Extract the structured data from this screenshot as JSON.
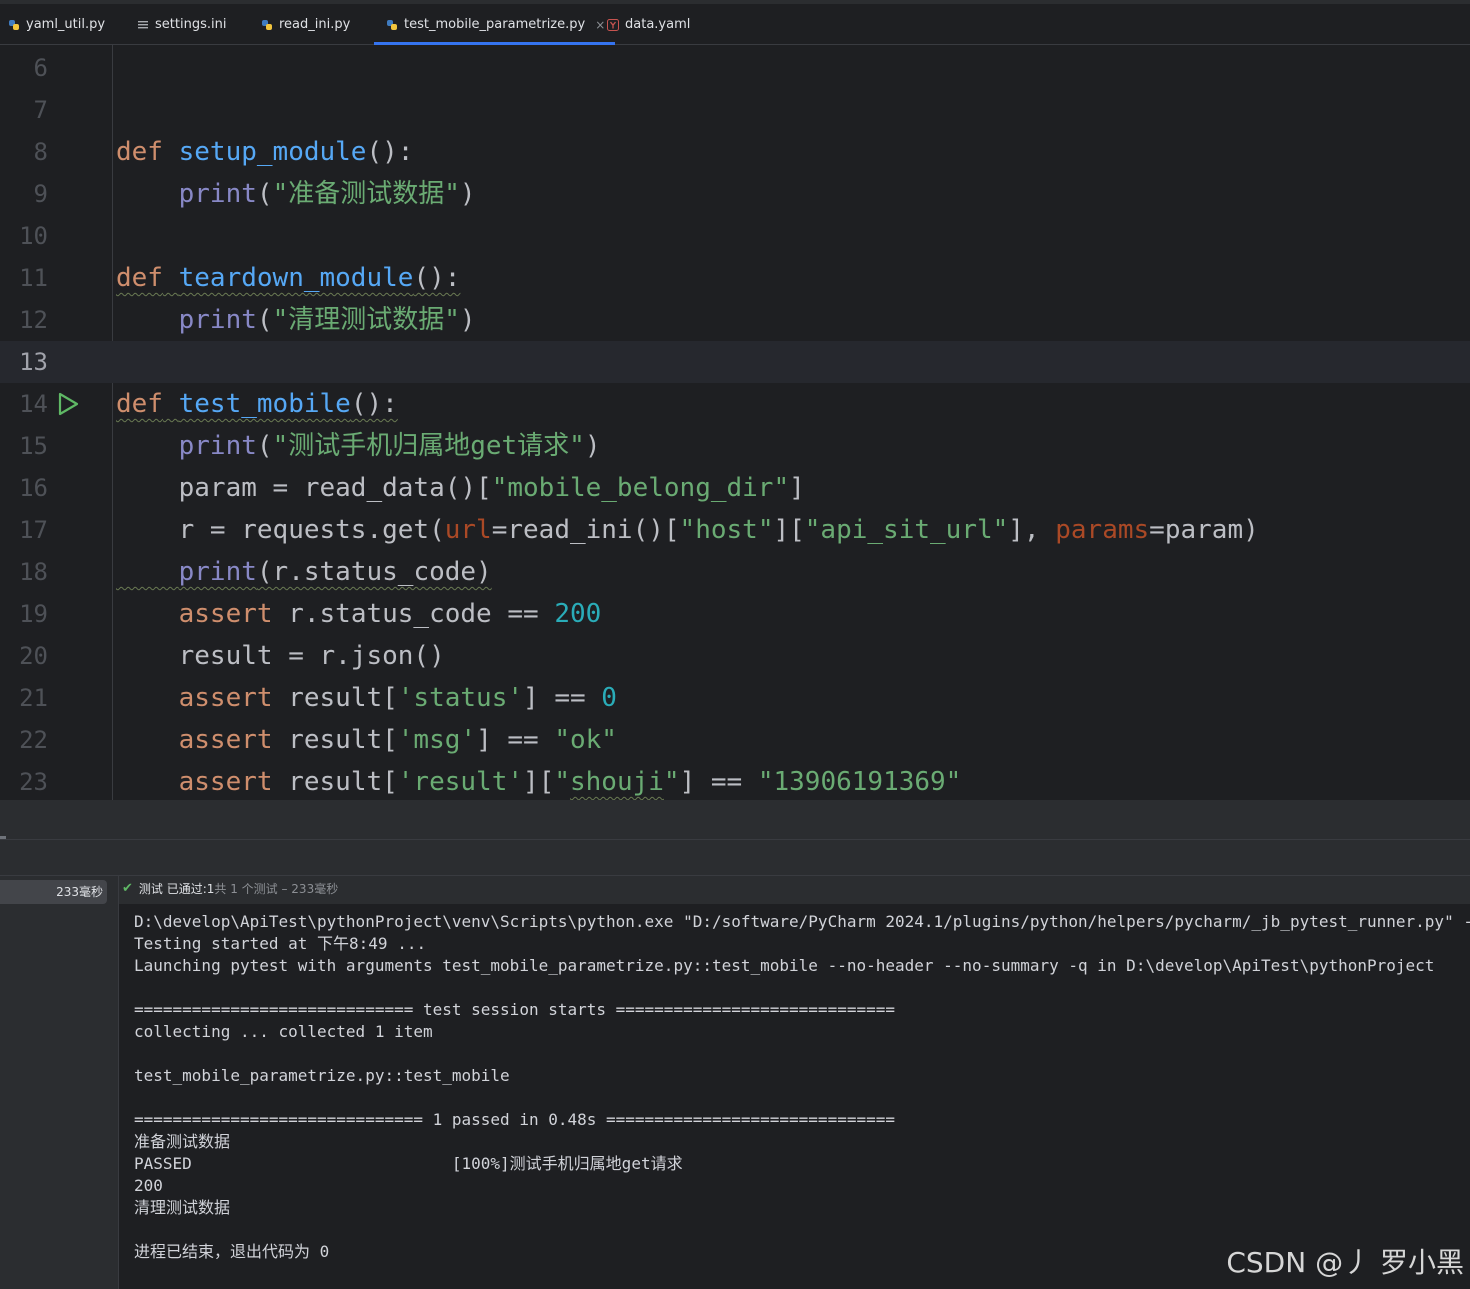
{
  "tabs": [
    {
      "label": "yaml_util.py",
      "icon": "python-icon"
    },
    {
      "label": "settings.ini",
      "icon": "ini-file-icon"
    },
    {
      "label": "read_ini.py",
      "icon": "python-icon"
    },
    {
      "label": "test_mobile_parametrize.py",
      "icon": "python-icon",
      "active": true,
      "close": "×"
    },
    {
      "label": "data.yaml",
      "icon": "yaml-icon"
    }
  ],
  "editor": {
    "line_numbers": [
      "6",
      "7",
      "8",
      "9",
      "10",
      "11",
      "12",
      "13",
      "14",
      "15",
      "16",
      "17",
      "18",
      "19",
      "20",
      "21",
      "22",
      "23"
    ],
    "current_line": "13",
    "code": {
      "l8": {
        "kw": "def",
        "fn": "setup_module",
        "tail": "():"
      },
      "l9": {
        "fn": "print",
        "a": "(",
        "str": "\"准备测试数据\"",
        "b": ")"
      },
      "l11": {
        "kw": "def",
        "fn": "teardown_module",
        "tail": "():"
      },
      "l12": {
        "fn": "print",
        "a": "(",
        "str": "\"清理测试数据\"",
        "b": ")"
      },
      "l14": {
        "kw": "def",
        "fn": "test_mobile",
        "tail": "():"
      },
      "l15": {
        "fn": "print",
        "a": "(",
        "str": "\"测试手机归属地get请求\"",
        "b": ")"
      },
      "l16": {
        "a": "param = read_data()[",
        "str": "\"mobile_belong_dir\"",
        "b": "]"
      },
      "l17": {
        "a": "r = requests.get(",
        "p1": "url",
        "b": "=read_ini()[",
        "s1": "\"host\"",
        "c": "][",
        "s2": "\"api_sit_url\"",
        "d": "], ",
        "p2": "params",
        "e": "=param)"
      },
      "l18": {
        "fn": "print",
        "a": "(r.status_code)"
      },
      "l19": {
        "kw": "assert",
        "a": " r.status_code == ",
        "num": "200"
      },
      "l20": {
        "a": "result = r.json()"
      },
      "l21": {
        "kw": "assert",
        "a": " result[",
        "str": "'status'",
        "b": "] == ",
        "num": "0"
      },
      "l22": {
        "kw": "assert",
        "a": " result[",
        "str": "'msg'",
        "b": "] == ",
        "s2": "\"ok\""
      },
      "l23": {
        "kw": "assert",
        "a": " result[",
        "s1": "'result'",
        "b": "][",
        "q1": "\"",
        "s2": "shouji",
        "q2": "\"",
        "c": "] == ",
        "s3": "\"13906191369\""
      }
    }
  },
  "test_panel": {
    "tree_duration": "233毫秒",
    "status_prefix": "测试 已通过: ",
    "status_count": "1",
    "status_suffix": "共 1 个测试 – 233毫秒"
  },
  "console_lines": [
    "D:\\develop\\ApiTest\\pythonProject\\venv\\Scripts\\python.exe \"D:/software/PyCharm 2024.1/plugins/python/helpers/pycharm/_jb_pytest_runner.py\" --target test_mobile_parametrize.py::test_mobile",
    "Testing started at 下午8:49 ...",
    "Launching pytest with arguments test_mobile_parametrize.py::test_mobile --no-header --no-summary -q in D:\\develop\\ApiTest\\pythonProject",
    "",
    "============================= test session starts =============================",
    "collecting ... collected 1 item",
    "",
    "test_mobile_parametrize.py::test_mobile",
    "",
    "============================== 1 passed in 0.48s ==============================",
    "准备测试数据",
    "PASSED                           [100%]测试手机归属地get请求",
    "200",
    "清理测试数据",
    "",
    "进程已结束，退出代码为 0"
  ],
  "watermark": "CSDN @丿 罗小黑",
  "colors": {
    "accent": "#3574f0",
    "keyword": "#cf8e6d",
    "function": "#56a8f5",
    "string": "#6aab73",
    "number": "#2aacb8",
    "param": "#aa4926",
    "run": "#5fb865"
  }
}
